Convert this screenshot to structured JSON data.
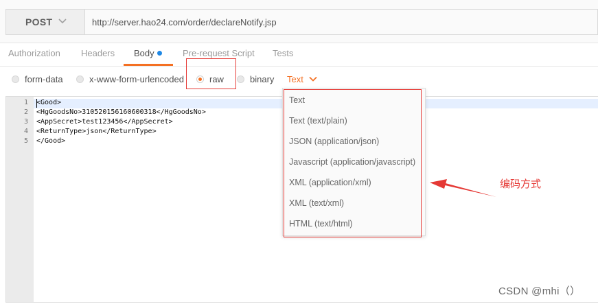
{
  "request": {
    "method": "POST",
    "url": "http://server.hao24.com/order/declareNotify.jsp"
  },
  "tabs": [
    {
      "label": "Authorization"
    },
    {
      "label": "Headers"
    },
    {
      "label": "Body"
    },
    {
      "label": "Pre-request Script"
    },
    {
      "label": "Tests"
    }
  ],
  "active_tab": "Body",
  "body_modes": [
    {
      "label": "form-data",
      "checked": false
    },
    {
      "label": "x-www-form-urlencoded",
      "checked": false
    },
    {
      "label": "raw",
      "checked": true
    },
    {
      "label": "binary",
      "checked": false
    }
  ],
  "content_type": {
    "selected": "Text",
    "options": [
      "Text",
      "Text (text/plain)",
      "JSON (application/json)",
      "Javascript (application/javascript)",
      "XML (application/xml)",
      "XML (text/xml)",
      "HTML (text/html)"
    ]
  },
  "editor": {
    "line_numbers": [
      "1",
      "2",
      "3",
      "4",
      "5"
    ],
    "lines": [
      "<Good>",
      "<HgGoodsNo>310520156160600318</HgGoodsNo>",
      "<AppSecret>test123456</AppSecret>",
      "<ReturnType>json</ReturnType>",
      "</Good>"
    ]
  },
  "annotation": "编码方式",
  "watermark": "CSDN @mhi（）",
  "colors": {
    "accent": "#f47023",
    "highlight_red": "#e53935",
    "body_dot": "#1e88e5"
  },
  "icons": {
    "method_dropdown": "chevron-down-icon",
    "content_type_dropdown": "chevron-down-icon",
    "annotation_pointer": "red-arrow-icon"
  }
}
